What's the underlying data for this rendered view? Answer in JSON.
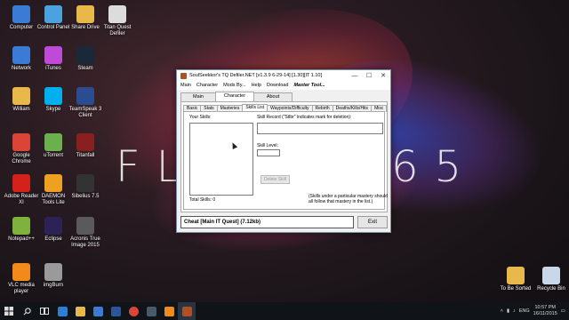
{
  "desktop": {
    "wallpaper_text_left": "FL",
    "wallpaper_text_right": "65",
    "icons": [
      {
        "label": "Computer",
        "icon": "computer-icon",
        "color": "#3a7bd5"
      },
      {
        "label": "Control Panel",
        "icon": "control-panel-icon",
        "color": "#4aa3df"
      },
      {
        "label": "Share Drive",
        "icon": "folder-icon",
        "color": "#e8b84a"
      },
      {
        "label": "Titan Quest Defiler",
        "icon": "document-icon",
        "color": "#dcdcdc"
      },
      {
        "label": "Network",
        "icon": "network-icon",
        "color": "#3a7bd5"
      },
      {
        "label": "iTunes",
        "icon": "itunes-icon",
        "color": "#c04ad8"
      },
      {
        "label": "Steam",
        "icon": "steam-icon",
        "color": "#1b2838"
      },
      {
        "label": "William",
        "icon": "user-folder-icon",
        "color": "#e8b84a"
      },
      {
        "label": "Skype",
        "icon": "skype-icon",
        "color": "#00aff0"
      },
      {
        "label": "TeamSpeak 3 Client",
        "icon": "teamspeak-icon",
        "color": "#2a4d8f"
      },
      {
        "label": "Google Chrome",
        "icon": "chrome-icon",
        "color": "#db4437"
      },
      {
        "label": "uTorrent",
        "icon": "utorrent-icon",
        "color": "#6ab04c"
      },
      {
        "label": "Titanfall",
        "icon": "titanfall-icon",
        "color": "#8a1f1f"
      },
      {
        "label": "Adobe Reader XI",
        "icon": "adobe-reader-icon",
        "color": "#d4221b"
      },
      {
        "label": "DAEMON Tools Lite",
        "icon": "daemon-tools-icon",
        "color": "#f0a020"
      },
      {
        "label": "Sibelius 7.5",
        "icon": "sibelius-icon",
        "color": "#333333"
      },
      {
        "label": "Notepad++",
        "icon": "notepad-plus-icon",
        "color": "#7fb13d"
      },
      {
        "label": "Eclipse",
        "icon": "eclipse-icon",
        "color": "#2c2255"
      },
      {
        "label": "Acronis True Image 2015",
        "icon": "acronis-icon",
        "color": "#5a5a5a"
      },
      {
        "label": "VLC media player",
        "icon": "vlc-icon",
        "color": "#f28a1a"
      },
      {
        "label": "imgBurn",
        "icon": "imgburn-icon",
        "color": "#9a9a9a"
      },
      {
        "label": "To Be Sorted",
        "icon": "folder-icon",
        "color": "#e8b84a"
      },
      {
        "label": "Recycle Bin",
        "icon": "recycle-bin-icon",
        "color": "#c8d8e8"
      }
    ]
  },
  "window": {
    "title": "SoulSeekkor's TQ Defiler.NET [v1.3.9 6-29-14] [1.30][IT 1.10]",
    "menu": [
      "Main",
      "Character",
      "Mods By...",
      "Help",
      "Download",
      "Master Tool..."
    ],
    "tabs": [
      "Main",
      "Character",
      "About"
    ],
    "subtabs": [
      "Basic",
      "Stats",
      "Masteries",
      "Skills List",
      "Waypoints/Difficulty",
      "Rebirth",
      "Deaths/Kills/Hits",
      "Misc"
    ],
    "your_skills_label": "Your Skills:",
    "skill_record_label": "Skill Record (\"Stlbr\" indicates mark for deletion):",
    "skill_level_label": "Skill Level:",
    "delete_skill_label": "Delete Skill",
    "total_skills_label": "Total Skills: 0",
    "note_line1": "(Skills under a particular mastery should",
    "note_line2": "all follow that mastery in the list.)",
    "status_text": "Cheat [Main IT Quest] (7.12kb)",
    "exit_label": "Exit"
  },
  "taskbar": {
    "language": "ENG",
    "time": "10:57 PM",
    "date": "16/11/2015"
  }
}
